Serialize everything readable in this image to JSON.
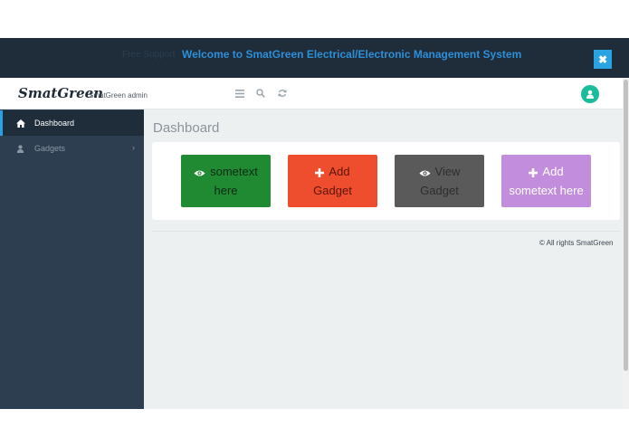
{
  "topbar": {
    "ghost_text": "Free Support",
    "welcome": "Welcome to SmatGreen Electrical/Electronic Management System",
    "close_label": "✖"
  },
  "header": {
    "logo": "SmatGreen",
    "subtitle": "SmatGreen admin"
  },
  "sidebar": {
    "items": [
      {
        "label": "Dashboard",
        "icon": "home-icon",
        "active": true
      },
      {
        "label": "Gadgets",
        "icon": "user-icon",
        "active": false,
        "chevron": "›"
      }
    ]
  },
  "main": {
    "title": "Dashboard",
    "tiles": [
      {
        "line1": "sometext",
        "line2": "here",
        "icon": "eye-icon",
        "color": "#1f8a32"
      },
      {
        "line1": "Add",
        "line2": "Gadget",
        "icon": "plus-icon",
        "color": "#ee4d2e"
      },
      {
        "line1": "View",
        "line2": "Gadget",
        "icon": "eye-icon",
        "color": "#5a5a5a"
      },
      {
        "line1": "Add",
        "line2": "sometext here",
        "icon": "plus-icon",
        "color": "#c28ddc"
      }
    ]
  },
  "footer": {
    "text": "© All rights SmatGreen"
  },
  "colors": {
    "sidebar": "#2c3e50",
    "topbar": "#1f2d3a",
    "accent": "#2aa3e3",
    "avatar": "#1abc9c"
  }
}
